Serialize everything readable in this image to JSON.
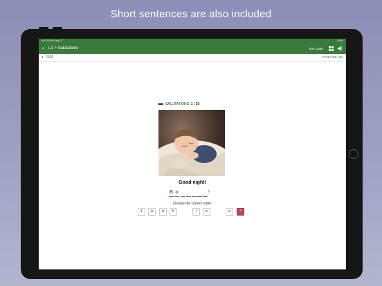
{
  "promo": {
    "caption": "Short sentences are also included"
  },
  "status_bar": {
    "time_date": "6:51 PM  Fri May 27",
    "battery": "100%"
  },
  "navbar": {
    "back_label": "‹",
    "title": "L1 > Salutations",
    "user_name": "Tom Cage",
    "sound_label": "◀)"
  },
  "subbar": {
    "score": "2105",
    "revise_label": "⟲ REVISE (15)"
  },
  "lesson": {
    "category": "SALUTATIONS:",
    "progress": "1 / 20",
    "phrase": "Good night!",
    "answer_letters": [
      "B",
      "o",
      "",
      "",
      "",
      "",
      "",
      ""
    ],
    "answer_end": "!",
    "instruction": "Choose the correct order:",
    "tiles": [
      "t",
      "n",
      "n",
      "h",
      "i",
      "e",
      "u",
      "?"
    ]
  },
  "colors": {
    "brand_green": "#3b7a3d",
    "help_tile": "#b44a52",
    "background": "#8b8fb7"
  }
}
